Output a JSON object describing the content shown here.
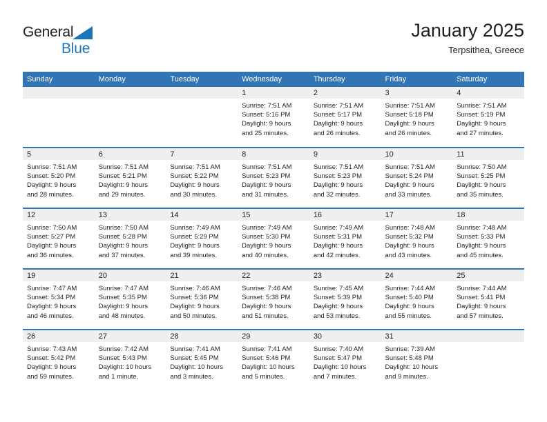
{
  "brand": {
    "name_top": "General",
    "name_bottom": "Blue",
    "triangle_color": "#1b75bb",
    "text_color": "#231f20"
  },
  "header": {
    "title": "January 2025",
    "subtitle": "Terpsithea, Greece"
  },
  "colors": {
    "header_blue": "#3275b4",
    "daynum_band": "#efefef",
    "text": "#231f20",
    "white": "#ffffff"
  },
  "weekday_headers": [
    "Sunday",
    "Monday",
    "Tuesday",
    "Wednesday",
    "Thursday",
    "Friday",
    "Saturday"
  ],
  "weeks": [
    [
      {
        "day": "",
        "lines": []
      },
      {
        "day": "",
        "lines": []
      },
      {
        "day": "",
        "lines": []
      },
      {
        "day": "1",
        "lines": [
          "Sunrise: 7:51 AM",
          "Sunset: 5:16 PM",
          "Daylight: 9 hours",
          "and 25 minutes."
        ]
      },
      {
        "day": "2",
        "lines": [
          "Sunrise: 7:51 AM",
          "Sunset: 5:17 PM",
          "Daylight: 9 hours",
          "and 26 minutes."
        ]
      },
      {
        "day": "3",
        "lines": [
          "Sunrise: 7:51 AM",
          "Sunset: 5:18 PM",
          "Daylight: 9 hours",
          "and 26 minutes."
        ]
      },
      {
        "day": "4",
        "lines": [
          "Sunrise: 7:51 AM",
          "Sunset: 5:19 PM",
          "Daylight: 9 hours",
          "and 27 minutes."
        ]
      }
    ],
    [
      {
        "day": "5",
        "lines": [
          "Sunrise: 7:51 AM",
          "Sunset: 5:20 PM",
          "Daylight: 9 hours",
          "and 28 minutes."
        ]
      },
      {
        "day": "6",
        "lines": [
          "Sunrise: 7:51 AM",
          "Sunset: 5:21 PM",
          "Daylight: 9 hours",
          "and 29 minutes."
        ]
      },
      {
        "day": "7",
        "lines": [
          "Sunrise: 7:51 AM",
          "Sunset: 5:22 PM",
          "Daylight: 9 hours",
          "and 30 minutes."
        ]
      },
      {
        "day": "8",
        "lines": [
          "Sunrise: 7:51 AM",
          "Sunset: 5:23 PM",
          "Daylight: 9 hours",
          "and 31 minutes."
        ]
      },
      {
        "day": "9",
        "lines": [
          "Sunrise: 7:51 AM",
          "Sunset: 5:23 PM",
          "Daylight: 9 hours",
          "and 32 minutes."
        ]
      },
      {
        "day": "10",
        "lines": [
          "Sunrise: 7:51 AM",
          "Sunset: 5:24 PM",
          "Daylight: 9 hours",
          "and 33 minutes."
        ]
      },
      {
        "day": "11",
        "lines": [
          "Sunrise: 7:50 AM",
          "Sunset: 5:25 PM",
          "Daylight: 9 hours",
          "and 35 minutes."
        ]
      }
    ],
    [
      {
        "day": "12",
        "lines": [
          "Sunrise: 7:50 AM",
          "Sunset: 5:27 PM",
          "Daylight: 9 hours",
          "and 36 minutes."
        ]
      },
      {
        "day": "13",
        "lines": [
          "Sunrise: 7:50 AM",
          "Sunset: 5:28 PM",
          "Daylight: 9 hours",
          "and 37 minutes."
        ]
      },
      {
        "day": "14",
        "lines": [
          "Sunrise: 7:49 AM",
          "Sunset: 5:29 PM",
          "Daylight: 9 hours",
          "and 39 minutes."
        ]
      },
      {
        "day": "15",
        "lines": [
          "Sunrise: 7:49 AM",
          "Sunset: 5:30 PM",
          "Daylight: 9 hours",
          "and 40 minutes."
        ]
      },
      {
        "day": "16",
        "lines": [
          "Sunrise: 7:49 AM",
          "Sunset: 5:31 PM",
          "Daylight: 9 hours",
          "and 42 minutes."
        ]
      },
      {
        "day": "17",
        "lines": [
          "Sunrise: 7:48 AM",
          "Sunset: 5:32 PM",
          "Daylight: 9 hours",
          "and 43 minutes."
        ]
      },
      {
        "day": "18",
        "lines": [
          "Sunrise: 7:48 AM",
          "Sunset: 5:33 PM",
          "Daylight: 9 hours",
          "and 45 minutes."
        ]
      }
    ],
    [
      {
        "day": "19",
        "lines": [
          "Sunrise: 7:47 AM",
          "Sunset: 5:34 PM",
          "Daylight: 9 hours",
          "and 46 minutes."
        ]
      },
      {
        "day": "20",
        "lines": [
          "Sunrise: 7:47 AM",
          "Sunset: 5:35 PM",
          "Daylight: 9 hours",
          "and 48 minutes."
        ]
      },
      {
        "day": "21",
        "lines": [
          "Sunrise: 7:46 AM",
          "Sunset: 5:36 PM",
          "Daylight: 9 hours",
          "and 50 minutes."
        ]
      },
      {
        "day": "22",
        "lines": [
          "Sunrise: 7:46 AM",
          "Sunset: 5:38 PM",
          "Daylight: 9 hours",
          "and 51 minutes."
        ]
      },
      {
        "day": "23",
        "lines": [
          "Sunrise: 7:45 AM",
          "Sunset: 5:39 PM",
          "Daylight: 9 hours",
          "and 53 minutes."
        ]
      },
      {
        "day": "24",
        "lines": [
          "Sunrise: 7:44 AM",
          "Sunset: 5:40 PM",
          "Daylight: 9 hours",
          "and 55 minutes."
        ]
      },
      {
        "day": "25",
        "lines": [
          "Sunrise: 7:44 AM",
          "Sunset: 5:41 PM",
          "Daylight: 9 hours",
          "and 57 minutes."
        ]
      }
    ],
    [
      {
        "day": "26",
        "lines": [
          "Sunrise: 7:43 AM",
          "Sunset: 5:42 PM",
          "Daylight: 9 hours",
          "and 59 minutes."
        ]
      },
      {
        "day": "27",
        "lines": [
          "Sunrise: 7:42 AM",
          "Sunset: 5:43 PM",
          "Daylight: 10 hours",
          "and 1 minute."
        ]
      },
      {
        "day": "28",
        "lines": [
          "Sunrise: 7:41 AM",
          "Sunset: 5:45 PM",
          "Daylight: 10 hours",
          "and 3 minutes."
        ]
      },
      {
        "day": "29",
        "lines": [
          "Sunrise: 7:41 AM",
          "Sunset: 5:46 PM",
          "Daylight: 10 hours",
          "and 5 minutes."
        ]
      },
      {
        "day": "30",
        "lines": [
          "Sunrise: 7:40 AM",
          "Sunset: 5:47 PM",
          "Daylight: 10 hours",
          "and 7 minutes."
        ]
      },
      {
        "day": "31",
        "lines": [
          "Sunrise: 7:39 AM",
          "Sunset: 5:48 PM",
          "Daylight: 10 hours",
          "and 9 minutes."
        ]
      },
      {
        "day": "",
        "lines": []
      }
    ]
  ]
}
